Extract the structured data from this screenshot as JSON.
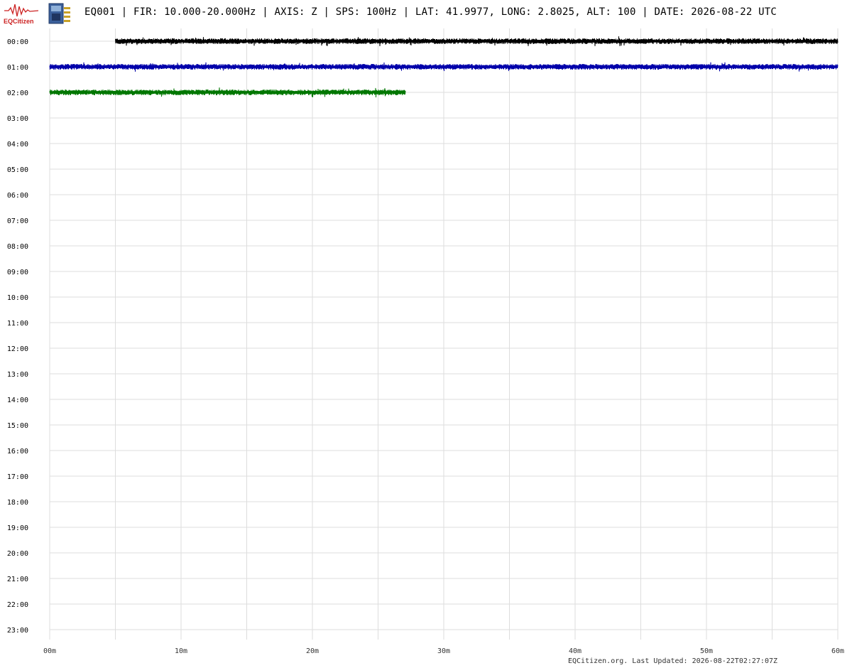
{
  "header": {
    "logo_text": "EQCitizen",
    "title": "EQ001 | FIR: 10.000-20.000Hz | AXIS: Z | SPS: 100Hz | LAT: 41.9977, LONG: 2.8025, ALT: 100 | DATE: 2026-08-22 UTC"
  },
  "footer": {
    "credit": "EQCitizen.org. Last Updated: 2026-08-22T02:27:07Z"
  },
  "colors": {
    "grid": "#dddddd",
    "logo": "#cc2222",
    "series": [
      "#000000",
      "#0000aa",
      "#007700"
    ]
  },
  "chart_data": {
    "type": "line",
    "title": "",
    "xlabel": "",
    "ylabel": "",
    "xlim": [
      0,
      60
    ],
    "x_ticks": [
      0,
      10,
      20,
      30,
      40,
      50,
      60
    ],
    "x_tick_labels": [
      "00m",
      "10m",
      "20m",
      "30m",
      "40m",
      "50m",
      "60m"
    ],
    "x_minor_grid": [
      5,
      15,
      25,
      35,
      45,
      55
    ],
    "rows": [
      "00:00",
      "01:00",
      "02:00",
      "03:00",
      "04:00",
      "05:00",
      "06:00",
      "07:00",
      "08:00",
      "09:00",
      "10:00",
      "11:00",
      "12:00",
      "13:00",
      "14:00",
      "15:00",
      "16:00",
      "17:00",
      "18:00",
      "19:00",
      "20:00",
      "21:00",
      "22:00",
      "23:00"
    ],
    "grid": true,
    "series": [
      {
        "row": "00:00",
        "start_min": 5.0,
        "end_min": 60.0,
        "color": "#000000"
      },
      {
        "row": "01:00",
        "start_min": 0.0,
        "end_min": 60.0,
        "color": "#0000aa"
      },
      {
        "row": "02:00",
        "start_min": 0.0,
        "end_min": 27.1,
        "color": "#007700"
      }
    ]
  }
}
